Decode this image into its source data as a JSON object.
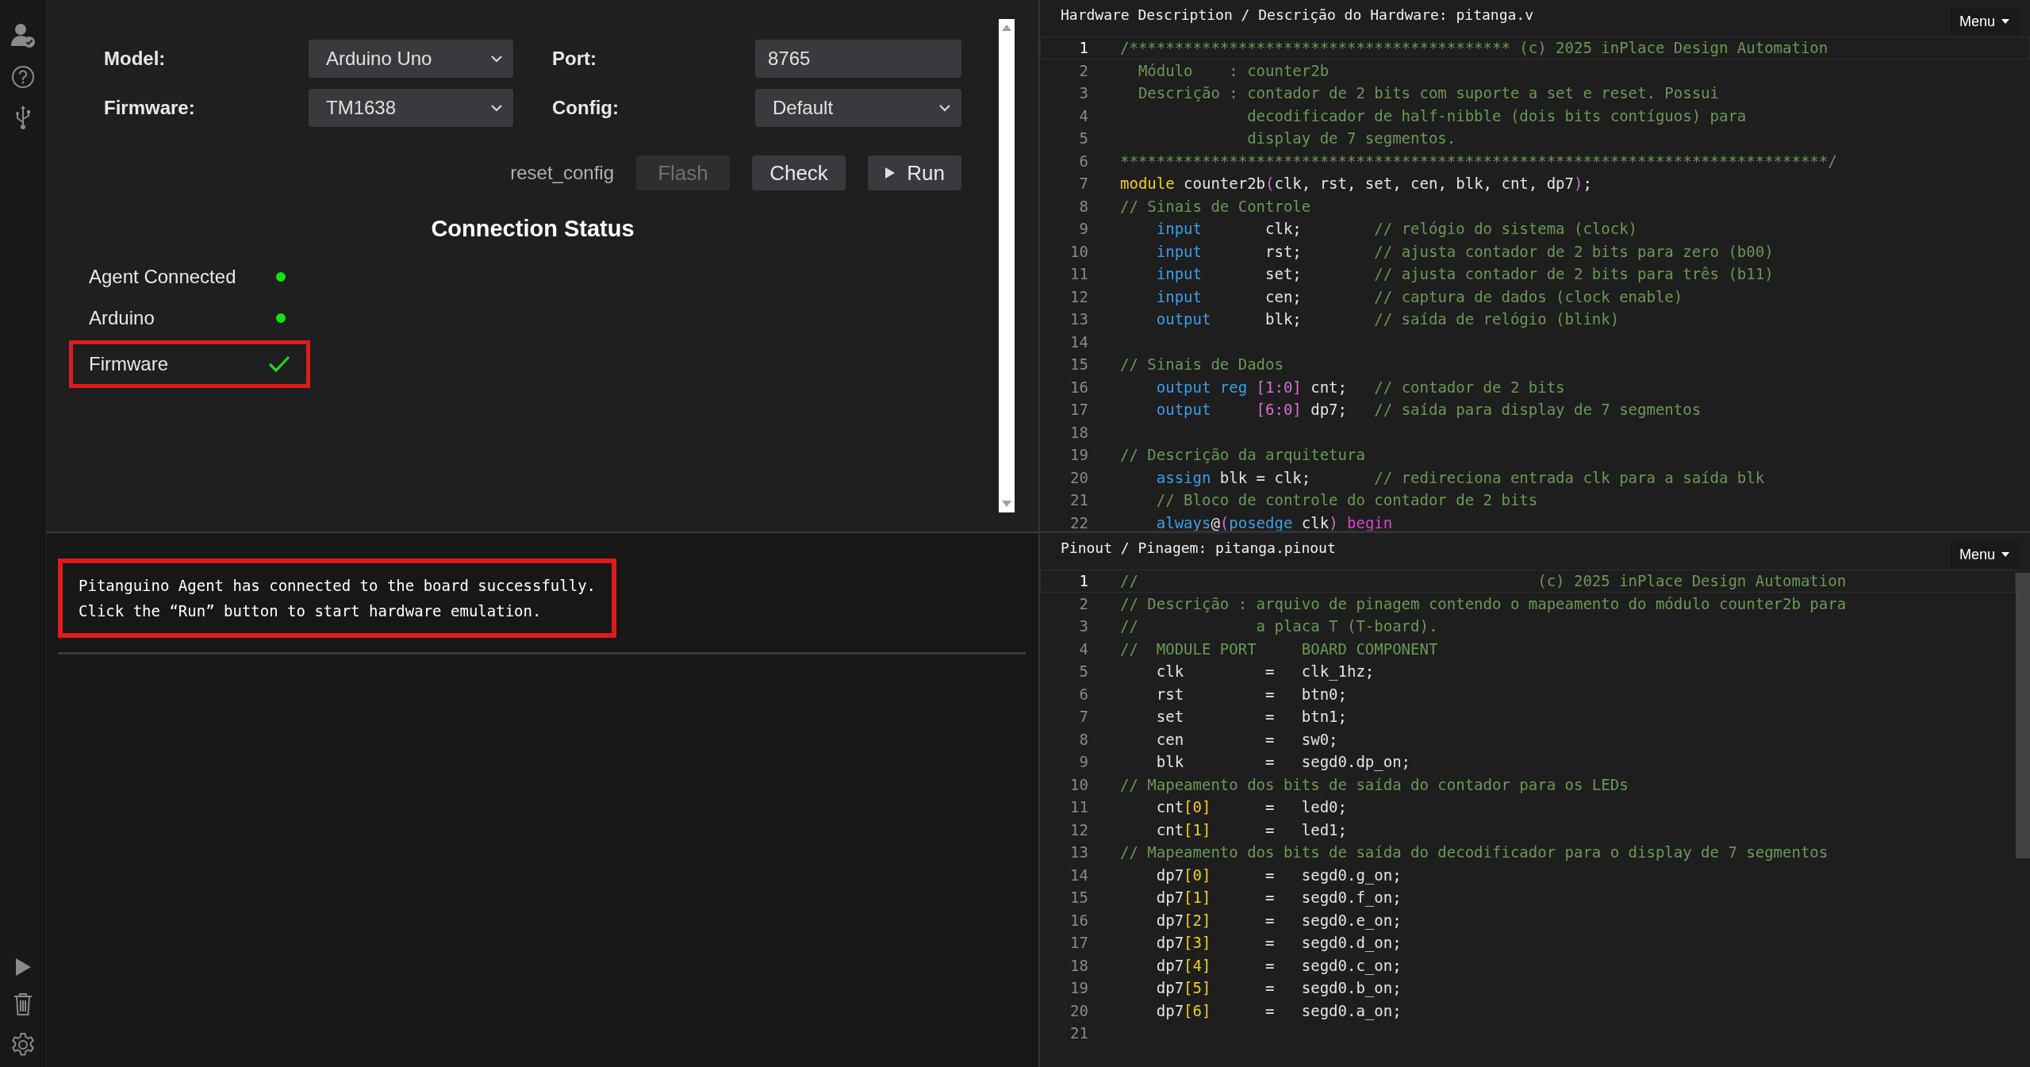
{
  "device_form": {
    "model": {
      "label": "Model:",
      "value": "Arduino Uno"
    },
    "firmware": {
      "label": "Firmware:",
      "value": "TM1638"
    },
    "port": {
      "label": "Port:",
      "value": "8765"
    },
    "config": {
      "label": "Config:",
      "value": "Default"
    }
  },
  "actions": [
    {
      "kind": "link",
      "label": "reset_config",
      "disabled": false
    },
    {
      "kind": "button",
      "label": "Flash",
      "disabled": true
    },
    {
      "kind": "button",
      "label": "Check",
      "disabled": false
    },
    {
      "kind": "run",
      "label": "Run",
      "disabled": false
    }
  ],
  "connection_status": {
    "title": "Connection Status",
    "items": [
      {
        "label": "Agent Connected",
        "kind": "dot",
        "highlighted": false
      },
      {
        "label": "Arduino",
        "kind": "dot",
        "highlighted": false
      },
      {
        "label": "Firmware",
        "kind": "check",
        "highlighted": true
      }
    ]
  },
  "console": {
    "highlighted": true,
    "lines": [
      "Pitanguino Agent has connected to the board successfully.",
      "Click the “Run” button to start hardware emulation."
    ]
  },
  "editors": [
    {
      "title": "Hardware Description / Descrição do Hardware: pitanga.v",
      "menu": "Menu",
      "scrollable": false,
      "lines": [
        {
          "n": "1",
          "current": true,
          "tokens": [
            {
              "kind": "comment",
              "text": "/****************************************** (c) 2025 inPlace Design Automation"
            }
          ]
        },
        {
          "n": "2",
          "current": false,
          "tokens": [
            {
              "kind": "comment",
              "text": "  Módulo    : counter2b"
            }
          ]
        },
        {
          "n": "3",
          "current": false,
          "tokens": [
            {
              "kind": "comment",
              "text": "  Descrição : contador de 2 bits com suporte a set e reset. Possui"
            }
          ]
        },
        {
          "n": "4",
          "current": false,
          "tokens": [
            {
              "kind": "comment",
              "text": "              decodificador de half-nibble (dois bits contíguos) para"
            }
          ]
        },
        {
          "n": "5",
          "current": false,
          "tokens": [
            {
              "kind": "comment",
              "text": "              display de 7 segmentos."
            }
          ]
        },
        {
          "n": "6",
          "current": false,
          "tokens": [
            {
              "kind": "comment",
              "text": "******************************************************************************/"
            }
          ]
        },
        {
          "n": "7",
          "current": false,
          "tokens": [
            {
              "kind": "module",
              "text": "module"
            },
            {
              "kind": "plain",
              "text": " counter2b"
            },
            {
              "kind": "bracket",
              "text": "("
            },
            {
              "kind": "plain",
              "text": "clk, rst, set, cen, blk, cnt, dp7"
            },
            {
              "kind": "bracket",
              "text": ")"
            },
            {
              "kind": "plain",
              "text": ";"
            }
          ]
        },
        {
          "n": "8",
          "current": false,
          "tokens": [
            {
              "kind": "comment",
              "text": "// Sinais de Controle"
            }
          ]
        },
        {
          "n": "9",
          "current": false,
          "tokens": [
            {
              "kind": "keyword",
              "text": "    input"
            },
            {
              "kind": "plain",
              "text": "       clk;"
            },
            {
              "kind": "comment",
              "text": "        // relógio do sistema (clock)"
            }
          ]
        },
        {
          "n": "10",
          "current": false,
          "tokens": [
            {
              "kind": "keyword",
              "text": "    input"
            },
            {
              "kind": "plain",
              "text": "       rst;"
            },
            {
              "kind": "comment",
              "text": "        // ajusta contador de 2 bits para zero (b00)"
            }
          ]
        },
        {
          "n": "11",
          "current": false,
          "tokens": [
            {
              "kind": "keyword",
              "text": "    input"
            },
            {
              "kind": "plain",
              "text": "       set;"
            },
            {
              "kind": "comment",
              "text": "        // ajusta contador de 2 bits para três (b11)"
            }
          ]
        },
        {
          "n": "12",
          "current": false,
          "tokens": [
            {
              "kind": "keyword",
              "text": "    input"
            },
            {
              "kind": "plain",
              "text": "       cen;"
            },
            {
              "kind": "comment",
              "text": "        // captura de dados (clock enable)"
            }
          ]
        },
        {
          "n": "13",
          "current": false,
          "tokens": [
            {
              "kind": "keyword",
              "text": "    output"
            },
            {
              "kind": "plain",
              "text": "      blk;"
            },
            {
              "kind": "comment",
              "text": "        // saída de relógio (blink)"
            }
          ]
        },
        {
          "n": "14",
          "current": false
        },
        {
          "n": "15",
          "current": false,
          "tokens": [
            {
              "kind": "comment",
              "text": "// Sinais de Dados"
            }
          ]
        },
        {
          "n": "16",
          "current": false,
          "tokens": [
            {
              "kind": "keyword",
              "text": "    output reg "
            },
            {
              "kind": "bracket",
              "text": "[1:0]"
            },
            {
              "kind": "plain",
              "text": " cnt;"
            },
            {
              "kind": "comment",
              "text": "   // contador de 2 bits"
            }
          ]
        },
        {
          "n": "17",
          "current": false,
          "tokens": [
            {
              "kind": "keyword",
              "text": "    output     "
            },
            {
              "kind": "bracket",
              "text": "[6:0]"
            },
            {
              "kind": "plain",
              "text": " dp7;"
            },
            {
              "kind": "comment",
              "text": "   // saída para display de 7 segmentos"
            }
          ]
        },
        {
          "n": "18",
          "current": false
        },
        {
          "n": "19",
          "current": false,
          "tokens": [
            {
              "kind": "comment",
              "text": "// Descrição da arquitetura"
            }
          ]
        },
        {
          "n": "20",
          "current": false,
          "tokens": [
            {
              "kind": "keyword",
              "text": "    assign"
            },
            {
              "kind": "plain",
              "text": " blk = clk;"
            },
            {
              "kind": "comment",
              "text": "       // redireciona entrada clk para a saída blk"
            }
          ]
        },
        {
          "n": "21",
          "current": false,
          "tokens": [
            {
              "kind": "comment",
              "text": "    // Bloco de controle do contador de 2 bits"
            }
          ]
        },
        {
          "n": "22",
          "current": false,
          "tokens": [
            {
              "kind": "keyword",
              "text": "    always"
            },
            {
              "kind": "plain",
              "text": "@"
            },
            {
              "kind": "bracket",
              "text": "("
            },
            {
              "kind": "keyword",
              "text": "posedge"
            },
            {
              "kind": "plain",
              "text": " clk"
            },
            {
              "kind": "bracket",
              "text": ")"
            },
            {
              "kind": "control",
              "text": " begin"
            }
          ]
        }
      ]
    },
    {
      "title": "Pinout / Pinagem: pitanga.pinout",
      "menu": "Menu",
      "scrollable": true,
      "lines": [
        {
          "n": "1",
          "current": true,
          "tokens": [
            {
              "kind": "comment",
              "text": "//                                            (c) 2025 inPlace Design Automation"
            }
          ]
        },
        {
          "n": "2",
          "current": false,
          "tokens": [
            {
              "kind": "comment",
              "text": "// Descrição : arquivo de pinagem contendo o mapeamento do módulo counter2b para"
            }
          ]
        },
        {
          "n": "3",
          "current": false,
          "tokens": [
            {
              "kind": "comment",
              "text": "//             a placa T (T-board)."
            }
          ]
        },
        {
          "n": "4",
          "current": false,
          "tokens": [
            {
              "kind": "comment",
              "text": "//  MODULE PORT     BOARD COMPONENT"
            }
          ]
        },
        {
          "n": "5",
          "current": false,
          "tokens": [
            {
              "kind": "plain",
              "text": "    clk         =   clk_1hz;"
            }
          ]
        },
        {
          "n": "6",
          "current": false,
          "tokens": [
            {
              "kind": "plain",
              "text": "    rst         =   btn0;"
            }
          ]
        },
        {
          "n": "7",
          "current": false,
          "tokens": [
            {
              "kind": "plain",
              "text": "    set         =   btn1;"
            }
          ]
        },
        {
          "n": "8",
          "current": false,
          "tokens": [
            {
              "kind": "plain",
              "text": "    cen         =   sw0;"
            }
          ]
        },
        {
          "n": "9",
          "current": false,
          "tokens": [
            {
              "kind": "plain",
              "text": "    blk         =   segd0.dp_on;"
            }
          ]
        },
        {
          "n": "10",
          "current": false,
          "tokens": [
            {
              "kind": "comment",
              "text": "// Mapeamento dos bits de saída do contador para os LEDs"
            }
          ]
        },
        {
          "n": "11",
          "current": false,
          "tokens": [
            {
              "kind": "plain",
              "text": "    cnt"
            },
            {
              "kind": "index",
              "text": "[0]"
            },
            {
              "kind": "plain",
              "text": "      =   led0;"
            }
          ]
        },
        {
          "n": "12",
          "current": false,
          "tokens": [
            {
              "kind": "plain",
              "text": "    cnt"
            },
            {
              "kind": "index",
              "text": "[1]"
            },
            {
              "kind": "plain",
              "text": "      =   led1;"
            }
          ]
        },
        {
          "n": "13",
          "current": false,
          "tokens": [
            {
              "kind": "comment",
              "text": "// Mapeamento dos bits de saída do decodificador para o display de 7 segmentos"
            }
          ]
        },
        {
          "n": "14",
          "current": false,
          "tokens": [
            {
              "kind": "plain",
              "text": "    dp7"
            },
            {
              "kind": "index",
              "text": "[0]"
            },
            {
              "kind": "plain",
              "text": "      =   segd0.g_on;"
            }
          ]
        },
        {
          "n": "15",
          "current": false,
          "tokens": [
            {
              "kind": "plain",
              "text": "    dp7"
            },
            {
              "kind": "index",
              "text": "[1]"
            },
            {
              "kind": "plain",
              "text": "      =   segd0.f_on;"
            }
          ]
        },
        {
          "n": "16",
          "current": false,
          "tokens": [
            {
              "kind": "plain",
              "text": "    dp7"
            },
            {
              "kind": "index",
              "text": "[2]"
            },
            {
              "kind": "plain",
              "text": "      =   segd0.e_on;"
            }
          ]
        },
        {
          "n": "17",
          "current": false,
          "tokens": [
            {
              "kind": "plain",
              "text": "    dp7"
            },
            {
              "kind": "index",
              "text": "[3]"
            },
            {
              "kind": "plain",
              "text": "      =   segd0.d_on;"
            }
          ]
        },
        {
          "n": "18",
          "current": false,
          "tokens": [
            {
              "kind": "plain",
              "text": "    dp7"
            },
            {
              "kind": "index",
              "text": "[4]"
            },
            {
              "kind": "plain",
              "text": "      =   segd0.c_on;"
            }
          ]
        },
        {
          "n": "19",
          "current": false,
          "tokens": [
            {
              "kind": "plain",
              "text": "    dp7"
            },
            {
              "kind": "index",
              "text": "[5]"
            },
            {
              "kind": "plain",
              "text": "      =   segd0.b_on;"
            }
          ]
        },
        {
          "n": "20",
          "current": false,
          "tokens": [
            {
              "kind": "plain",
              "text": "    dp7"
            },
            {
              "kind": "index",
              "text": "[6]"
            },
            {
              "kind": "plain",
              "text": "      =   segd0.a_on;"
            }
          ]
        },
        {
          "n": "21",
          "current": false
        }
      ]
    }
  ]
}
